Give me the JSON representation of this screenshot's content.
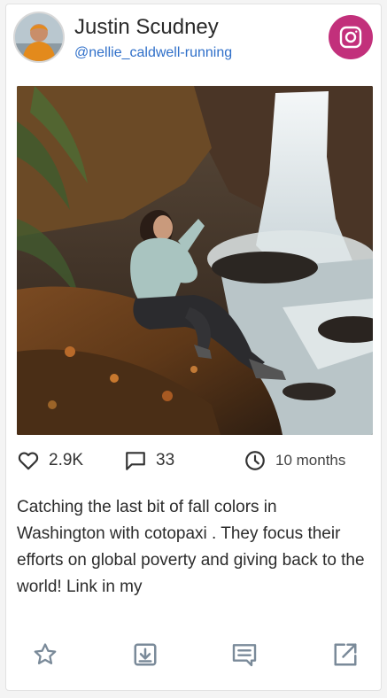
{
  "profile": {
    "name": "Justin Scudney",
    "handle": "@nellie_caldwell-running"
  },
  "platform_icon": "instagram-icon",
  "post": {
    "likes": "2.9K",
    "comments": "33",
    "age": "10 months",
    "caption": "Catching the last bit of fall colors in Washington with cotopaxi . They focus their efforts on global poverty and giving back to the world! Link in my"
  },
  "actions": [
    {
      "icon": "star-icon"
    },
    {
      "icon": "download-icon"
    },
    {
      "icon": "comment-icon"
    },
    {
      "icon": "external-link-icon"
    }
  ],
  "colors": {
    "instagram_badge": "#c2307b",
    "handle_link": "#2f6fc9",
    "action_icons": "#7a8a99"
  }
}
